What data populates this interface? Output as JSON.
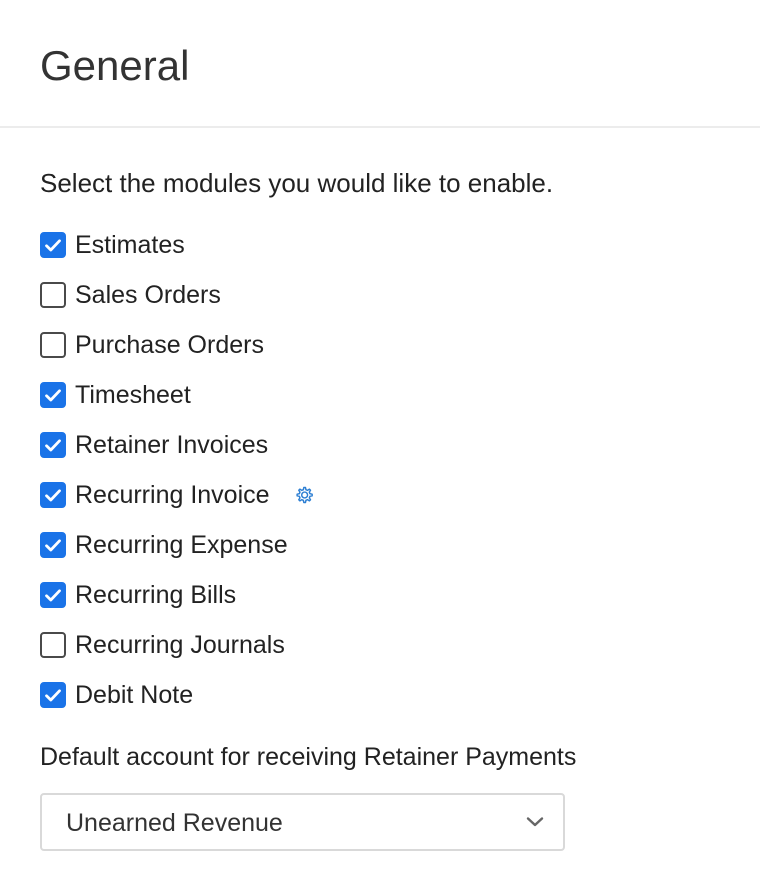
{
  "page": {
    "title": "General"
  },
  "modules_section": {
    "intro": "Select the modules you would like to enable.",
    "items": [
      {
        "label": "Estimates",
        "checked": true
      },
      {
        "label": "Sales Orders",
        "checked": false
      },
      {
        "label": "Purchase Orders",
        "checked": false
      },
      {
        "label": "Timesheet",
        "checked": true
      },
      {
        "label": "Retainer Invoices",
        "checked": true
      },
      {
        "label": "Recurring Invoice",
        "checked": true,
        "icon": "gear-icon"
      },
      {
        "label": "Recurring Expense",
        "checked": true
      },
      {
        "label": "Recurring Bills",
        "checked": true
      },
      {
        "label": "Recurring Journals",
        "checked": false
      },
      {
        "label": "Debit Note",
        "checked": true
      }
    ]
  },
  "retainer_account": {
    "label": "Default account for receiving Retainer Payments",
    "selected": "Unearned Revenue",
    "icon": "chevron-down-icon"
  },
  "colors": {
    "checkbox_checked": "#1a73e8",
    "gear_icon": "#2d7fd3",
    "divider": "#ececec"
  }
}
